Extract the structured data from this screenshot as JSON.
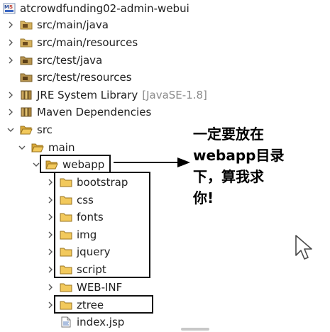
{
  "tree": {
    "project": {
      "label": "atcrowdfunding02-admin-webui",
      "icon": "maven-project-icon"
    },
    "items": [
      {
        "label": "src/main/java",
        "icon": "source-folder-icon"
      },
      {
        "label": "src/main/resources",
        "icon": "source-folder-icon"
      },
      {
        "label": "src/test/java",
        "icon": "source-folder-icon"
      },
      {
        "label": "src/test/resources",
        "icon": "source-folder-icon"
      },
      {
        "label": "JRE System Library",
        "decoration": "[JavaSE-1.8]",
        "icon": "library-icon"
      },
      {
        "label": "Maven Dependencies",
        "icon": "library-icon"
      },
      {
        "label": "src",
        "icon": "folder-icon"
      },
      {
        "label": "main",
        "icon": "folder-icon"
      },
      {
        "label": "webapp",
        "icon": "folder-icon"
      },
      {
        "label": "bootstrap",
        "icon": "folder-icon"
      },
      {
        "label": "css",
        "icon": "folder-icon"
      },
      {
        "label": "fonts",
        "icon": "folder-icon"
      },
      {
        "label": "img",
        "icon": "folder-icon"
      },
      {
        "label": "jquery",
        "icon": "folder-icon"
      },
      {
        "label": "script",
        "icon": "folder-icon"
      },
      {
        "label": "WEB-INF",
        "icon": "folder-icon"
      },
      {
        "label": "ztree",
        "icon": "folder-icon"
      },
      {
        "label": "index.jsp",
        "icon": "jsp-file-icon"
      }
    ]
  },
  "annotation": {
    "lines": [
      "一定要放在",
      "webapp目录",
      "下，算我求",
      "你!"
    ]
  },
  "colors": {
    "folder": "#e8b84a",
    "source_folder": "#b89550",
    "jar": "#8a6d3b",
    "chevron": "#555555",
    "highlight_border": "#111111"
  }
}
